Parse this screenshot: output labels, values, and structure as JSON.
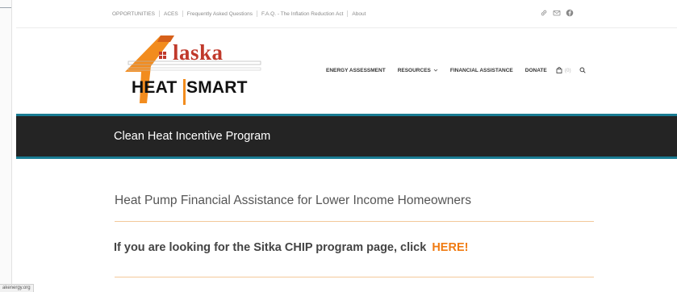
{
  "top_links": [
    "OPPORTUNITIES",
    "ACES",
    "Frequently Asked Questions",
    "F.A.Q. - The Inflation Reduction Act",
    "About"
  ],
  "social_icons": [
    "link-icon",
    "mail-icon",
    "facebook-icon"
  ],
  "logo": {
    "word1": "laska",
    "word2": "HEAT",
    "word3": "SMART"
  },
  "nav": {
    "items": [
      "ENERGY ASSESSMENT",
      "RESOURCES",
      "FINANCIAL ASSISTANCE",
      "DONATE"
    ],
    "cart_count": "(0)"
  },
  "banner": {
    "title": "Clean Heat Incentive Program"
  },
  "content": {
    "subtitle": "Heat Pump Financial Assistance for Lower Income Homeowners",
    "cta_text": "If you are looking for the Sitka CHIP program page, click",
    "cta_link": "HERE!"
  },
  "status_tab": "akenergy.org",
  "colors": {
    "accent_orange": "#f07b12",
    "teal": "#197c93",
    "banner_bg": "#242424",
    "logo_red": "#c0392b",
    "divider": "#f3c89a"
  }
}
